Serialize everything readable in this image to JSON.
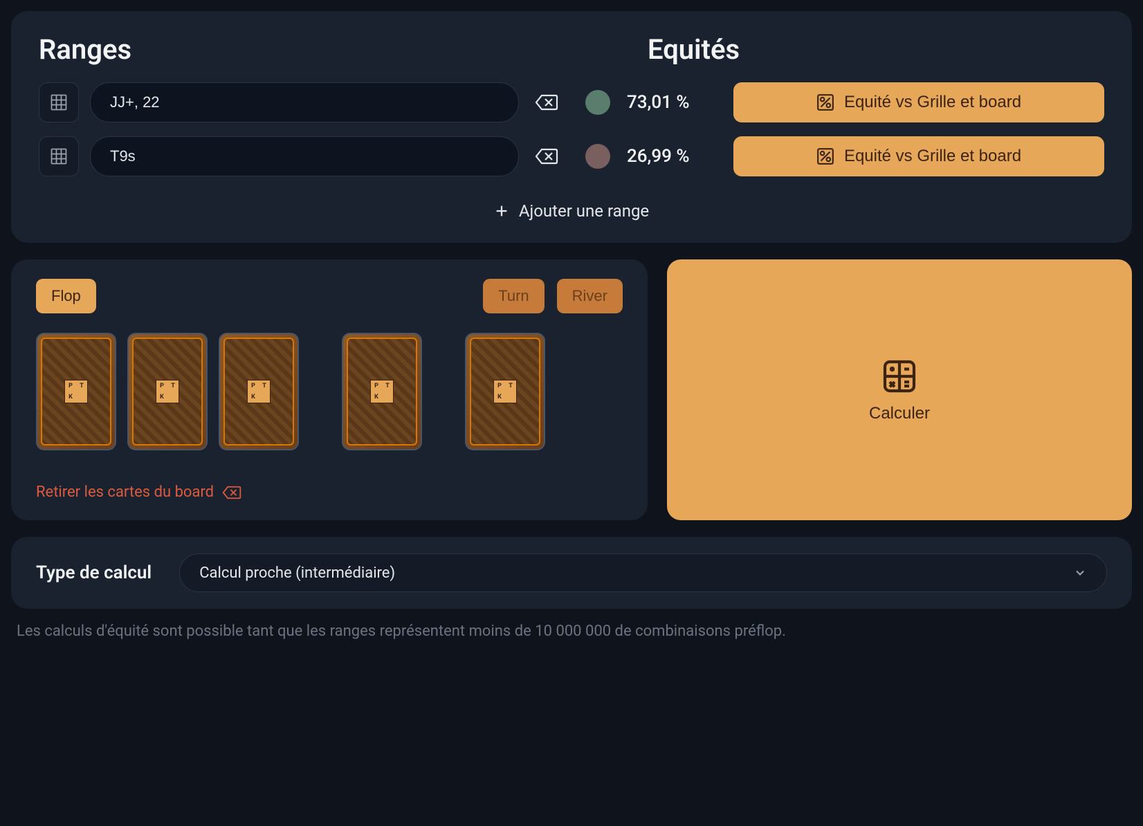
{
  "headers": {
    "ranges": "Ranges",
    "equities": "Equités"
  },
  "ranges": [
    {
      "value": "JJ+, 22",
      "color": "#5a7d6e",
      "equity": "73,01 %",
      "equity_btn": "Equité vs Grille et board"
    },
    {
      "value": "T9s",
      "color": "#7a5f5f",
      "equity": "26,99 %",
      "equity_btn": "Equité vs Grille et board"
    }
  ],
  "add_range": "Ajouter une range",
  "streets": {
    "flop": "Flop",
    "turn": "Turn",
    "river": "River"
  },
  "remove_cards": "Retirer les cartes du board",
  "calculate": "Calculer",
  "calc_type": {
    "label": "Type de calcul",
    "selected": "Calcul proche (intermédiaire)"
  },
  "footer": "Les calculs d'équité sont possible tant que les ranges représentent moins de 10 000 000 de combinaisons préflop."
}
